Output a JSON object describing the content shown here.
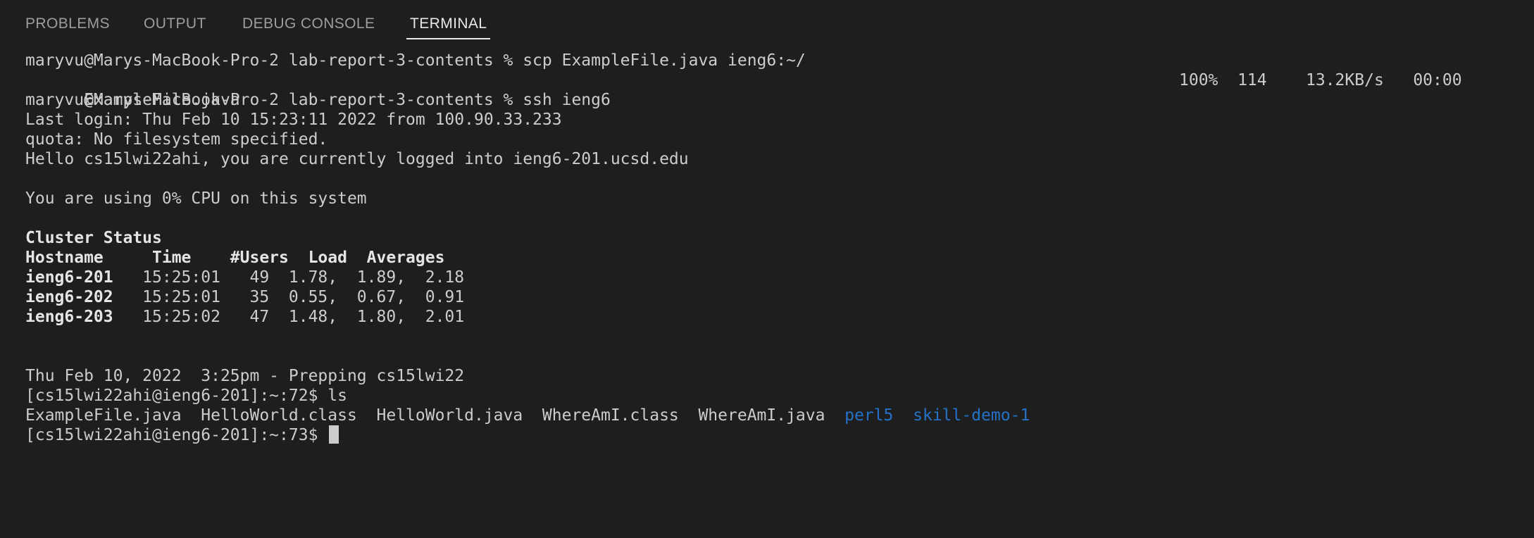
{
  "tabs": [
    {
      "label": "PROBLEMS"
    },
    {
      "label": "OUTPUT"
    },
    {
      "label": "DEBUG CONSOLE"
    },
    {
      "label": "TERMINAL"
    }
  ],
  "active_tab": "TERMINAL",
  "colors": {
    "background": "#1e1e1e",
    "text": "#cccccc",
    "directory": "#2472c8",
    "tab_inactive": "#9d9d9d",
    "tab_active": "#e7e7e7"
  },
  "terminal": {
    "scp_command": "maryvu@Marys-MacBook-Pro-2 lab-report-3-contents % scp ExampleFile.java ieng6:~/",
    "scp_file": "ExampleFile.java",
    "scp_progress": "100%  114    13.2KB/s   00:00",
    "ssh_command": "maryvu@Marys-MacBook-Pro-2 lab-report-3-contents % ssh ieng6",
    "last_login": "Last login: Thu Feb 10 15:23:11 2022 from 100.90.33.233",
    "quota": "quota: No filesystem specified.",
    "hello": "Hello cs15lwi22ahi, you are currently logged into ieng6-201.ucsd.edu",
    "cpu": "You are using 0% CPU on this system",
    "cluster_title": "Cluster Status",
    "cluster_header": "Hostname     Time    #Users  Load  Averages",
    "cluster_rows": [
      {
        "host": "ieng6-201",
        "rest": "   15:25:01   49  1.78,  1.89,  2.18"
      },
      {
        "host": "ieng6-202",
        "rest": "   15:25:01   35  0.55,  0.67,  0.91"
      },
      {
        "host": "ieng6-203",
        "rest": "   15:25:02   47  1.48,  1.80,  2.01"
      }
    ],
    "prep": "Thu Feb 10, 2022  3:25pm - Prepping cs15lwi22",
    "ls_command": "[cs15lwi22ahi@ieng6-201]:~:72$ ls",
    "ls_files": "ExampleFile.java  HelloWorld.class  HelloWorld.java  WhereAmI.class  WhereAmI.java  ",
    "ls_dirs": [
      "perl5",
      "skill-demo-1"
    ],
    "ls_dir_separator": "  ",
    "prompt": "[cs15lwi22ahi@ieng6-201]:~:73$ "
  }
}
